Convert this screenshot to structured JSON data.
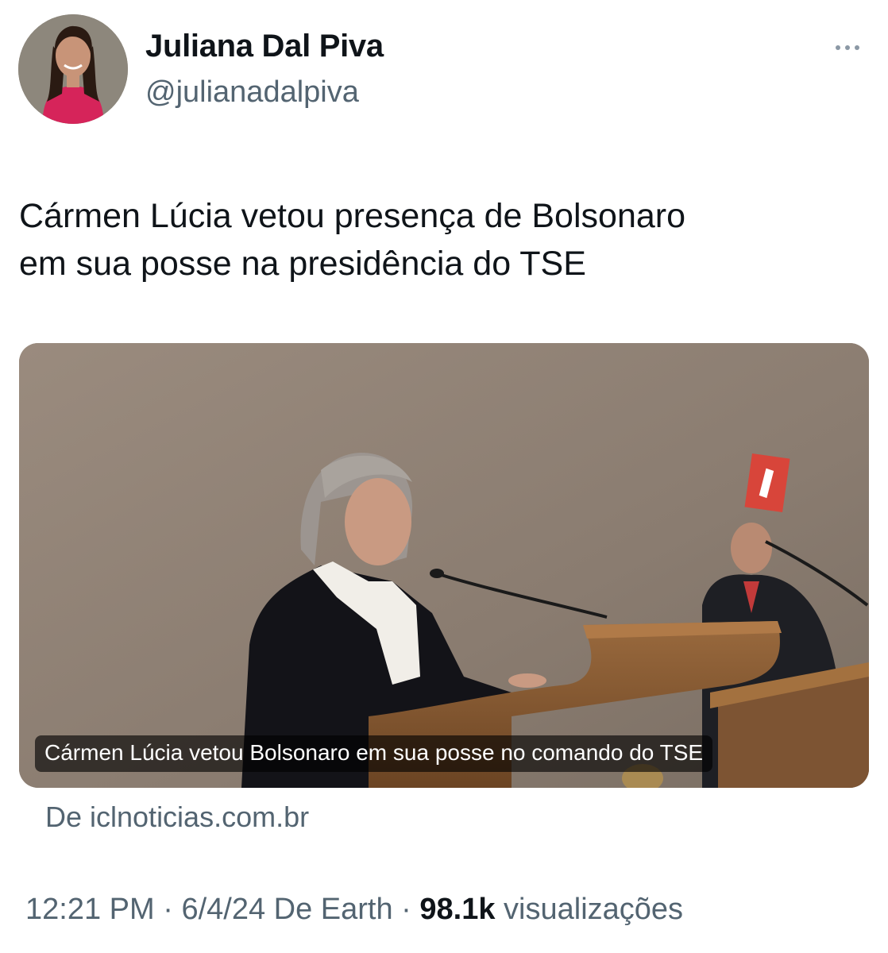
{
  "author": {
    "name": "Juliana Dal Piva",
    "handle": "@julianadalpiva",
    "avatar_icon": "profile-photo"
  },
  "tweet": {
    "text": "Cármen Lúcia vetou presença de Bolsonaro\nem sua posse na presidência do TSE"
  },
  "link_card": {
    "caption": "Cármen Lúcia vetou Bolsonaro em sua posse no comando do TSE",
    "source": "De iclnoticias.com.br"
  },
  "meta": {
    "time": "12:21 PM",
    "separator": " · ",
    "date_source": "6/4/24 De Earth",
    "views_count": "98.1k",
    "views_label": "visualizações"
  },
  "icons": {
    "more": "more-horizontal-icon"
  },
  "colors": {
    "text_primary": "#0f1419",
    "text_secondary": "#536471"
  }
}
